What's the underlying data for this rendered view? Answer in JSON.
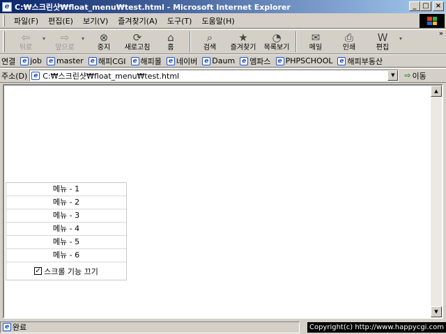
{
  "window": {
    "title": "C:₩스크린샷₩float_menu₩test.html - Microsoft Internet Explorer",
    "minimize": "_",
    "maximize": "□",
    "close": "×"
  },
  "menubar": [
    "파일(F)",
    "편집(E)",
    "보기(V)",
    "즐겨찾기(A)",
    "도구(T)",
    "도움말(H)"
  ],
  "toolbar": {
    "back": "뒤로",
    "forward": "앞으로",
    "stop": "중지",
    "refresh": "새로고침",
    "home": "홈",
    "search": "검색",
    "favorites": "즐겨찾기",
    "history": "목록보기",
    "mail": "메일",
    "print": "인쇄",
    "edit": "편집",
    "more": "»"
  },
  "icons": {
    "back": "back-arrow-icon",
    "forward": "forward-arrow-icon",
    "stop": "stop-icon",
    "refresh": "refresh-icon",
    "home": "home-icon",
    "search": "search-icon",
    "favorites": "favorites-icon",
    "history": "history-icon",
    "mail": "mail-icon",
    "print": "print-icon",
    "edit": "edit-icon"
  },
  "links": {
    "label": "연결",
    "items": [
      "job",
      "master",
      "해피CGI",
      "해피몰",
      "네이버",
      "Daum",
      "엠파스",
      "PHPSCHOOL",
      "해피부동산"
    ]
  },
  "address": {
    "label": "주소(D)",
    "value": "C:₩스크린샷₩float_menu₩test.html",
    "go": "이동"
  },
  "float_menu": {
    "items": [
      "메뉴 - 1",
      "메뉴 - 2",
      "메뉴 - 3",
      "메뉴 - 4",
      "메뉴 - 5",
      "메뉴 - 6"
    ],
    "option": "스크롤 기능 끄기",
    "option_checked": true
  },
  "status": {
    "text": "완료",
    "copyright": "Copyright(c) http://www.happycgi.com"
  },
  "colors": {
    "title_start": "#0a246a",
    "title_end": "#a6caf0",
    "chrome": "#d4d0c8"
  }
}
